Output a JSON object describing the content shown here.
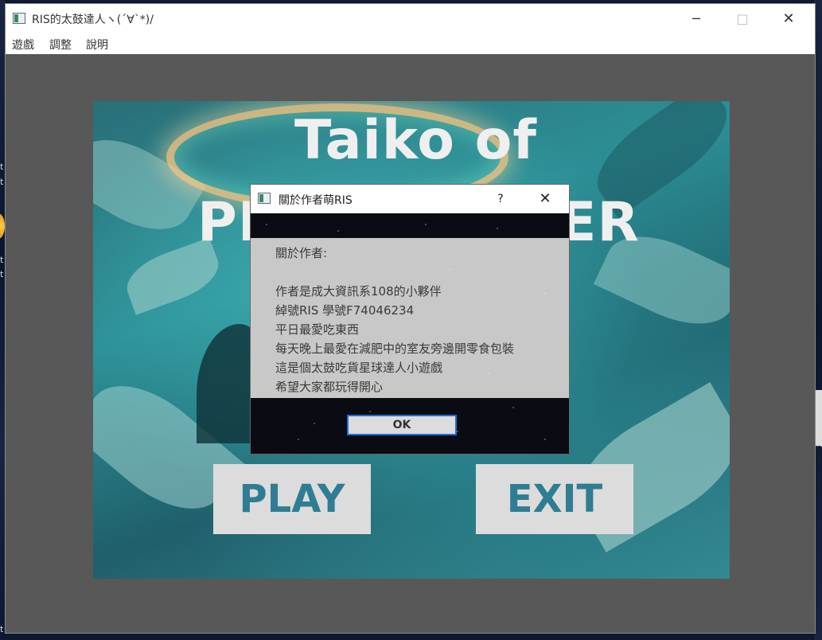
{
  "window": {
    "title": "RIS的太鼓達人ヽ(´∀`*)/",
    "minimize_glyph": "─",
    "maximize_glyph": "□",
    "close_glyph": "✕"
  },
  "menubar": {
    "items": [
      {
        "label": "遊戲"
      },
      {
        "label": "調整"
      },
      {
        "label": "說明"
      }
    ]
  },
  "scene": {
    "title_line1": "Taiko of",
    "title_line2_left": "PL",
    "title_line2_right": "ER",
    "play_label": "PLAY",
    "exit_label": "EXIT"
  },
  "dialog": {
    "title": "關於作者萌RIS",
    "help_glyph": "?",
    "close_glyph": "✕",
    "lines": [
      "關於作者:",
      "作者是成大資訊系108的小夥伴",
      "綽號RIS 學號F74046234",
      "平日最愛吃東西",
      "每天晚上最愛在減肥中的室友旁邊開零食包裝",
      "這是個太鼓吃貨星球達人小遊戲",
      "希望大家都玩得開心"
    ],
    "ok_label": "OK"
  },
  "desktop": {
    "fragments": [
      "t",
      "t",
      "t",
      "t",
      "ne",
      "t"
    ]
  },
  "colors": {
    "button_text": "#2f7d93",
    "button_bg": "#dcdcdc",
    "dialog_focus": "#1e6fd0",
    "window_bg": "#585858"
  }
}
